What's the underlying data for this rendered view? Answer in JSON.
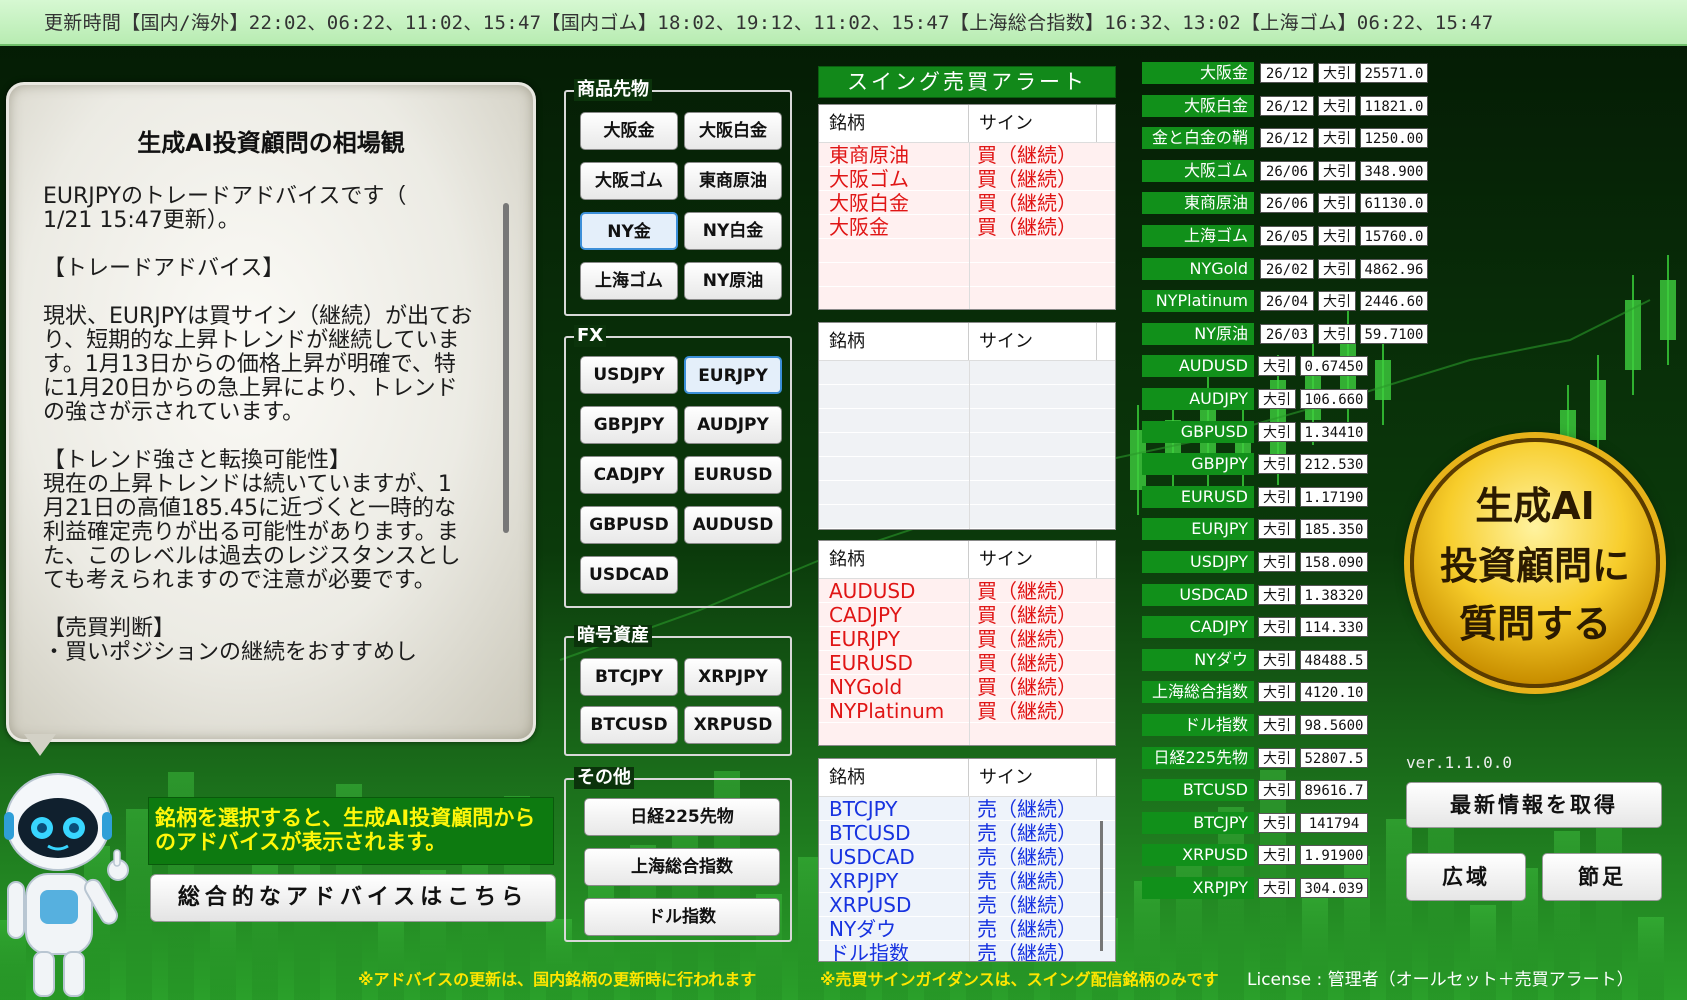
{
  "topbar": {
    "text": "更新時間【国内/海外】22:02、06:22、11:02、15:47【国内ゴム】18:02、19:12、11:02、15:47【上海総合指数】16:32、13:02【上海ゴム】06:22、15:47"
  },
  "advice": {
    "title": "生成AI投資顧問の相場観",
    "body": "EURJPYのトレードアドバイスです（\n1/21 15:47更新）。\n\n【トレードアドバイス】\n\n現状、EURJPYは買サイン（継続）が出ており、短期的な上昇トレンドが継続しています。1月13日からの価格上昇が明確で、特に1月20日からの急上昇により、トレンドの強さが示されています。\n\n【トレンド強さと転換可能性】\n現在の上昇トレンドは続いていますが、1月21日の高値185.45に近づくと一時的な利益確定売りが出る可能性があります。また、このレベルは過去のレジスタンスとしても考えられますので注意が必要です。\n\n【売買判断】\n・買いポジションの継続をおすすめし"
  },
  "hint": "銘柄を選択すると、生成AI投資顧問からのアドバイスが表示されます。",
  "overall_button": "総合的なアドバイスはこちら",
  "groups": {
    "commodity": {
      "legend": "商品先物",
      "buttons": [
        "大阪金",
        "大阪白金",
        "大阪ゴム",
        "東商原油",
        "NY金",
        "NY白金",
        "上海ゴム",
        "NY原油"
      ]
    },
    "fx": {
      "legend": "FX",
      "buttons": [
        "USDJPY",
        "EURJPY",
        "GBPJPY",
        "AUDJPY",
        "CADJPY",
        "EURUSD",
        "GBPUSD",
        "AUDUSD",
        "USDCAD"
      ]
    },
    "crypto": {
      "legend": "暗号資産",
      "buttons": [
        "BTCJPY",
        "XRPJPY",
        "BTCUSD",
        "XRPUSD"
      ]
    },
    "other": {
      "legend": "その他",
      "buttons": [
        "日経225先物",
        "上海総合指数",
        "ドル指数"
      ]
    }
  },
  "alert": {
    "header": "スイング売買アラート",
    "col_name": "銘柄",
    "col_sign": "サイン",
    "table1": [
      {
        "name": "東商原油",
        "sign": "買（継続）"
      },
      {
        "name": "大阪ゴム",
        "sign": "買（継続）"
      },
      {
        "name": "大阪白金",
        "sign": "買（継続）"
      },
      {
        "name": "大阪金",
        "sign": "買（継続）"
      }
    ],
    "table2": [],
    "table3": [
      {
        "name": "AUDUSD",
        "sign": "買（継続）"
      },
      {
        "name": "CADJPY",
        "sign": "買（継続）"
      },
      {
        "name": "EURJPY",
        "sign": "買（継続）"
      },
      {
        "name": "EURUSD",
        "sign": "買（継続）"
      },
      {
        "name": "NYGold",
        "sign": "買（継続）"
      },
      {
        "name": "NYPlatinum",
        "sign": "買（継続）"
      }
    ],
    "table4": [
      {
        "name": "BTCJPY",
        "sign": "売（継続）"
      },
      {
        "name": "BTCUSD",
        "sign": "売（継続）"
      },
      {
        "name": "USDCAD",
        "sign": "売（継続）"
      },
      {
        "name": "XRPJPY",
        "sign": "売（継続）"
      },
      {
        "name": "XRPUSD",
        "sign": "売（継続）"
      },
      {
        "name": "NYダウ",
        "sign": "売（継続）"
      },
      {
        "name": "ドル指数",
        "sign": "売（継続）"
      }
    ]
  },
  "prices": [
    {
      "name": "大阪金",
      "date": "26/12",
      "kind": "大引",
      "value": "25571.0"
    },
    {
      "name": "大阪白金",
      "date": "26/12",
      "kind": "大引",
      "value": "11821.0"
    },
    {
      "name": "金と白金の鞘",
      "date": "26/12",
      "kind": "大引",
      "value": "1250.00"
    },
    {
      "name": "大阪ゴム",
      "date": "26/06",
      "kind": "大引",
      "value": "348.900"
    },
    {
      "name": "東商原油",
      "date": "26/06",
      "kind": "大引",
      "value": "61130.0"
    },
    {
      "name": "上海ゴム",
      "date": "26/05",
      "kind": "大引",
      "value": "15760.0"
    },
    {
      "name": "NYGold",
      "date": "26/02",
      "kind": "大引",
      "value": "4862.96"
    },
    {
      "name": "NYPlatinum",
      "date": "26/04",
      "kind": "大引",
      "value": "2446.60"
    },
    {
      "name": "NY原油",
      "date": "26/03",
      "kind": "大引",
      "value": "59.7100"
    },
    {
      "name": "AUDUSD",
      "kind": "大引",
      "value": "0.67450"
    },
    {
      "name": "AUDJPY",
      "kind": "大引",
      "value": "106.660"
    },
    {
      "name": "GBPUSD",
      "kind": "大引",
      "value": "1.34410"
    },
    {
      "name": "GBPJPY",
      "kind": "大引",
      "value": "212.530"
    },
    {
      "name": "EURUSD",
      "kind": "大引",
      "value": "1.17190"
    },
    {
      "name": "EURJPY",
      "kind": "大引",
      "value": "185.350"
    },
    {
      "name": "USDJPY",
      "kind": "大引",
      "value": "158.090"
    },
    {
      "name": "USDCAD",
      "kind": "大引",
      "value": "1.38320"
    },
    {
      "name": "CADJPY",
      "kind": "大引",
      "value": "114.330"
    },
    {
      "name": "NYダウ",
      "kind": "大引",
      "value": "48488.5"
    },
    {
      "name": "上海総合指数",
      "kind": "大引",
      "value": "4120.10"
    },
    {
      "name": "ドル指数",
      "kind": "大引",
      "value": "98.5600"
    },
    {
      "name": "日経225先物",
      "kind": "大引",
      "value": "52807.5"
    },
    {
      "name": "BTCUSD",
      "kind": "大引",
      "value": "89616.7"
    },
    {
      "name": "BTCJPY",
      "kind": "大引",
      "value": "141794"
    },
    {
      "name": "XRPUSD",
      "kind": "大引",
      "value": "1.91900"
    },
    {
      "name": "XRPJPY",
      "kind": "大引",
      "value": "304.039"
    }
  ],
  "ai_button": [
    "生成AI",
    "投資顧問に",
    "質問する"
  ],
  "version": "ver.1.1.0.0",
  "fetch_button": "最新情報を取得",
  "wide_button": "広域",
  "footstep_button": "節足",
  "footnote_left": "※アドバイスの更新は、国内銘柄の更新時に行われます",
  "footnote_right": "※売買サインガイダンスは、スイング配信銘柄のみです",
  "license": "License : 管理者（オールセット＋売買アラート）",
  "colors": {
    "accent_green": "#12891a",
    "buy_red": "#e01515",
    "sell_blue": "#1733e0",
    "hint_yellow": "#fff70a"
  }
}
